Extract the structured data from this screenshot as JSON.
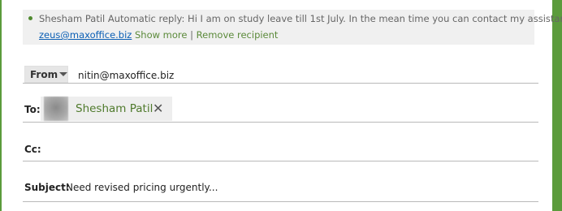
{
  "mailtip": {
    "sender": "Shesham Patil",
    "text": "Automatic reply:  Hi   I am on study leave till 1st July. In the mean time you can contact my assistant",
    "assistant_email": "zeus@maxoffice.biz",
    "show_more": "Show more",
    "separator": "|",
    "remove_recipient": "Remove recipient"
  },
  "from": {
    "button_label": "From",
    "value": "nitin@maxoffice.biz"
  },
  "to": {
    "label": "To:",
    "recipients": [
      {
        "name": "Shesham Patil",
        "remove_icon": "close-icon"
      }
    ]
  },
  "cc": {
    "label": "Cc:",
    "value": ""
  },
  "subject": {
    "label": "Subject:",
    "value": "Need revised pricing urgently..."
  },
  "colors": {
    "frame_accent": "#5b9b3c",
    "recipient_name": "#4f7a2c",
    "link": "#0b5fb5",
    "action_link": "#5b8a3a"
  }
}
